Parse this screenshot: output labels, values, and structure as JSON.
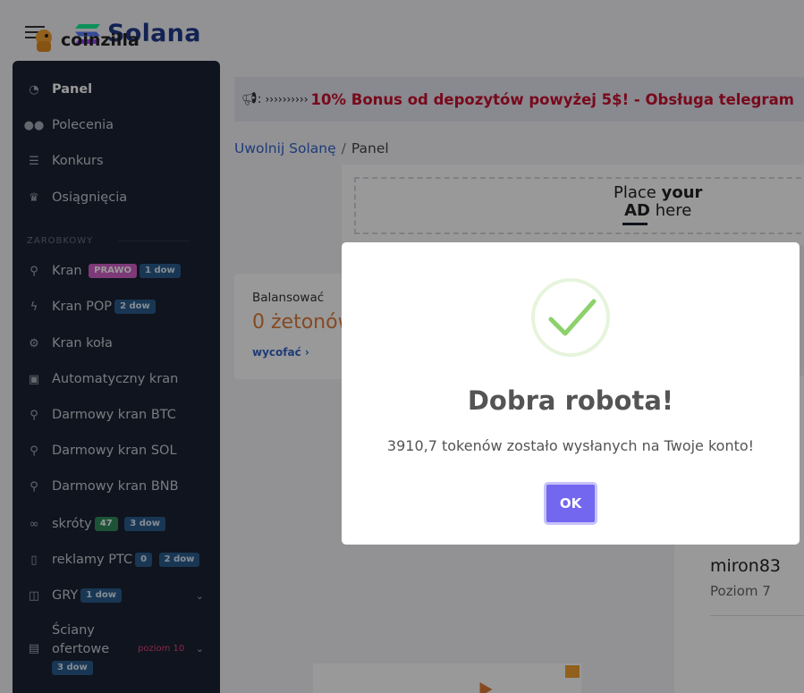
{
  "brand": {
    "name": "Solana"
  },
  "sidebar": {
    "items": [
      {
        "label": "Panel",
        "icon": "pie-chart-icon",
        "active": true
      },
      {
        "label": "Polecenia",
        "icon": "users-icon"
      },
      {
        "label": "Konkurs",
        "icon": "list-icon"
      },
      {
        "label": "Osiągnięcia",
        "icon": "trophy-icon"
      }
    ],
    "section_title": "ZAROBKOWY",
    "earn_items": [
      {
        "label": "Kran",
        "icon": "faucet-icon",
        "badges": [
          "PRAWO",
          "1 dow"
        ]
      },
      {
        "label": "Kran POP",
        "icon": "bolt-icon",
        "badges": [
          "2 dow"
        ]
      },
      {
        "label": "Kran koła",
        "icon": "wheel-icon",
        "badges": []
      },
      {
        "label": "Automatyczny kran",
        "icon": "robot-icon",
        "badges": []
      },
      {
        "label": "Darmowy kran BTC",
        "icon": "faucet-icon",
        "badges": []
      },
      {
        "label": "Darmowy kran SOL",
        "icon": "faucet-icon",
        "badges": []
      },
      {
        "label": "Darmowy kran BNB",
        "icon": "faucet-icon",
        "badges": []
      },
      {
        "label": "skróty",
        "icon": "link-icon",
        "badges": [
          "47",
          "3 dow"
        ]
      },
      {
        "label": "reklamy PTC",
        "icon": "mouse-icon",
        "badges": [
          "0",
          "2 dow"
        ]
      },
      {
        "label": "GRY",
        "icon": "gamepad-icon",
        "badges": [
          "1 dow"
        ]
      },
      {
        "label": "Ściany",
        "label2": "ofertowe",
        "icon": "wall-icon",
        "badges": [
          "3 dow"
        ],
        "extra": "poziom 10"
      }
    ]
  },
  "announcement": {
    "arrows": "››››››››››",
    "message": "10% Bonus od depozytów powyżej 5$! - Obsługa telegram"
  },
  "breadcrumb": {
    "root": "Uwolnij Solanę",
    "separator": "/",
    "current": "Panel"
  },
  "ad": {
    "brand": "coinzilla",
    "place_line1_a": "Place",
    "place_line1_b": "your",
    "place_line2_a": "AD",
    "place_line2_b": "here"
  },
  "balance": {
    "label": "Balansować",
    "value": "0 żetonów",
    "withdraw": "wycofać ›"
  },
  "user": {
    "name": "miron83",
    "level": "Poziom 7"
  },
  "modal": {
    "title": "Dobra robota!",
    "text": "3910,7 tokenów zostało wysłanych na Twoje konto!",
    "ok": "OK"
  },
  "colors": {
    "accent": "#7367f0",
    "success": "#8cd16b",
    "announce_red": "#c8102e",
    "sidebar_bg": "#1a2232"
  }
}
